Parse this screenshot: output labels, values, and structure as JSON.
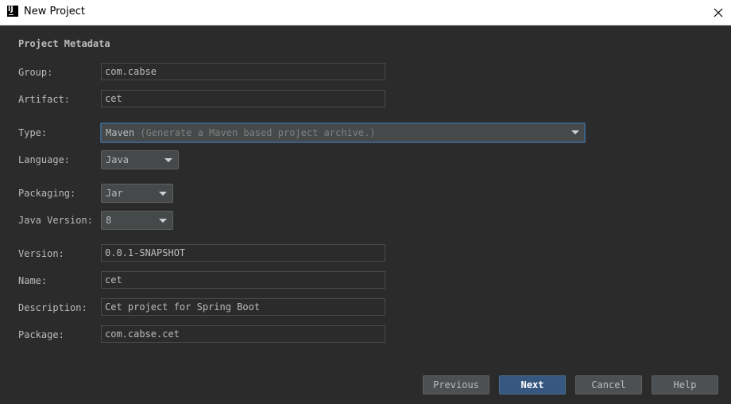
{
  "window": {
    "title": "New Project",
    "logo_text": "IJ"
  },
  "section": {
    "title": "Project Metadata"
  },
  "fields": {
    "group": {
      "label": "Group:",
      "value": "com.cabse"
    },
    "artifact": {
      "label": "Artifact:",
      "value": "cet"
    },
    "type": {
      "label": "Type:",
      "value": "Maven",
      "hint": "(Generate a Maven based project archive.)"
    },
    "language": {
      "label": "Language:",
      "value": "Java"
    },
    "packaging": {
      "label": "Packaging:",
      "value": "Jar"
    },
    "java_version": {
      "label": "Java Version:",
      "value": "8"
    },
    "version": {
      "label": "Version:",
      "value": "0.0.1-SNAPSHOT"
    },
    "name": {
      "label": "Name:",
      "value": "cet"
    },
    "description": {
      "label": "Description:",
      "value": "Cet project for Spring Boot"
    },
    "package": {
      "label": "Package:",
      "value": "com.cabse.cet"
    }
  },
  "buttons": {
    "previous": "Previous",
    "next": "Next",
    "cancel": "Cancel",
    "help": "Help"
  },
  "colors": {
    "background": "#2b2b2b",
    "primary_button": "#365880",
    "focus_border": "#3d6185"
  },
  "icons": {
    "close": "close-icon",
    "app": "intellij-logo-icon",
    "dropdown": "chevron-down-icon"
  }
}
